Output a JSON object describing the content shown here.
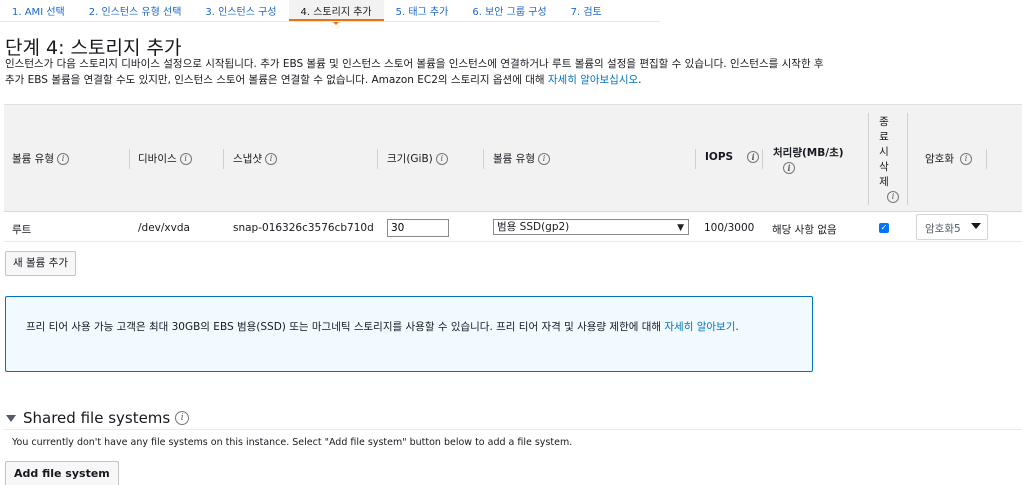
{
  "tabs": [
    {
      "label": "1. AMI 선택"
    },
    {
      "label": "2. 인스턴스 유형 선택"
    },
    {
      "label": "3. 인스턴스 구성"
    },
    {
      "label": "4. 스토리지 추가"
    },
    {
      "label": "5. 태그 추가"
    },
    {
      "label": "6. 보안 그룹 구성"
    },
    {
      "label": "7. 검토"
    }
  ],
  "title": "단계 4: 스토리지 추가",
  "description": {
    "text": "인스턴스가 다음 스토리지 디바이스 설정으로 시작됩니다. 추가 EBS 볼륨 및 인스턴스 스토어 볼륨을 인스턴스에 연결하거나 루트 볼륨의 설정을 편집할 수 있습니다. 인스턴스를 시작한 후 추가 EBS 볼륨을 연결할 수도 있지만, 인스턴스 스토어 볼륨은 연결할 수 없습니다. Amazon EC2의 스토리지 옵션에 대해 ",
    "link": "자세히 알아보십시오",
    "suffix": "."
  },
  "table": {
    "headers": {
      "volume_type": "볼륨 유형",
      "device": "디바이스",
      "snapshot": "스냅샷",
      "size": "크기(GiB)",
      "ebs_type": "볼륨 유형",
      "iops": "IOPS",
      "throughput": "처리량(MB/초)",
      "delete_on_termination": [
        "종",
        "료",
        "시",
        "삭",
        "제"
      ],
      "encryption": "암호화"
    },
    "info_glyph": "i",
    "row": {
      "volume_type": "루트",
      "device": "/dev/xvda",
      "snapshot": "snap-016326c3576cb710d",
      "size": "30",
      "ebs_type": "범용 SSD(gp2)",
      "iops": "100/3000",
      "throughput": "해당 사항 없음",
      "delete_checked": true,
      "encryption": "암호화5"
    }
  },
  "add_volume_button": "새 볼륨 추가",
  "notice": {
    "text": "프리 티어 사용 가능 고객은 최대 30GB의 EBS 범용(SSD) 또는 마그네틱 스토리지를 사용할 수 있습니다. 프리 티어 자격 및 사용량 제한에 대해 ",
    "link": "자세히 알아보기",
    "suffix": "."
  },
  "shared_fs": {
    "title": "Shared file systems",
    "description": "You currently don't have any file systems on this instance. Select \"Add file system\" button below to add a file system.",
    "add_button": "Add file system"
  },
  "colors": {
    "accent": "#ec7211",
    "link": "#0073bb",
    "notice_border": "#0073bb",
    "notice_bg": "#f1faff"
  }
}
